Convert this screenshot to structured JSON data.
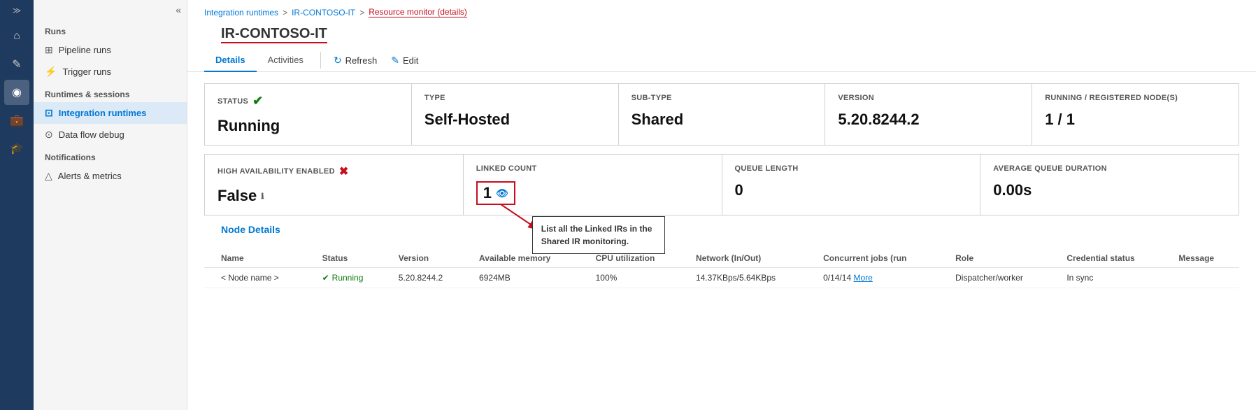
{
  "sidebar": {
    "icons": [
      {
        "name": "expand-icon",
        "symbol": "≫",
        "tooltip": "Expand"
      },
      {
        "name": "home-icon",
        "symbol": "⌂",
        "tooltip": "Home"
      },
      {
        "name": "pencil-icon",
        "symbol": "✎",
        "tooltip": "Author"
      },
      {
        "name": "monitor-icon",
        "symbol": "◉",
        "tooltip": "Monitor",
        "active": true
      },
      {
        "name": "briefcase-icon",
        "symbol": "💼",
        "tooltip": "Manage"
      },
      {
        "name": "graduation-icon",
        "symbol": "🎓",
        "tooltip": "Learn"
      }
    ]
  },
  "leftnav": {
    "collapse_symbol": "«",
    "sections": [
      {
        "label": "Runs",
        "items": [
          {
            "name": "pipeline-runs",
            "icon": "⊞",
            "label": "Pipeline runs"
          },
          {
            "name": "trigger-runs",
            "icon": "⚡",
            "label": "Trigger runs"
          }
        ]
      },
      {
        "label": "Runtimes & sessions",
        "items": [
          {
            "name": "integration-runtimes",
            "icon": "⊡",
            "label": "Integration runtimes",
            "active": true
          },
          {
            "name": "data-flow-debug",
            "icon": "⊙",
            "label": "Data flow debug"
          }
        ]
      },
      {
        "label": "Notifications",
        "items": [
          {
            "name": "alerts-metrics",
            "icon": "△",
            "label": "Alerts & metrics"
          }
        ]
      }
    ]
  },
  "breadcrumb": {
    "items": [
      {
        "label": "Integration runtimes",
        "link": true
      },
      {
        "label": "IR-CONTOSO-IT",
        "link": true
      },
      {
        "label": "Resource monitor (details)",
        "current": true
      }
    ]
  },
  "page_title": "IR-CONTOSO-IT",
  "tabs": [
    {
      "label": "Details",
      "active": true
    },
    {
      "label": "Activities"
    }
  ],
  "toolbar": {
    "refresh_label": "Refresh",
    "refresh_icon": "↻",
    "edit_label": "Edit",
    "edit_icon": "✎"
  },
  "cards_row1": [
    {
      "id": "status",
      "label": "STATUS",
      "value": "Running",
      "icon": "✔",
      "icon_type": "green"
    },
    {
      "id": "type",
      "label": "TYPE",
      "value": "Self-Hosted"
    },
    {
      "id": "subtype",
      "label": "SUB-TYPE",
      "value": "Shared"
    },
    {
      "id": "version",
      "label": "VERSION",
      "value": "5.20.8244.2"
    },
    {
      "id": "running-nodes",
      "label": "RUNNING / REGISTERED NODE(S)",
      "value": "1 / 1"
    }
  ],
  "cards_row2": [
    {
      "id": "ha-enabled",
      "label": "HIGH AVAILABILITY ENABLED",
      "value": "False",
      "icon": "✖",
      "icon_type": "red",
      "info": true
    },
    {
      "id": "linked-count",
      "label": "LINKED COUNT",
      "value": "1",
      "eye": true
    },
    {
      "id": "queue-length",
      "label": "QUEUE LENGTH",
      "value": "0"
    },
    {
      "id": "avg-queue",
      "label": "AVERAGE QUEUE DURATION",
      "value": "0.00s"
    }
  ],
  "tooltip": {
    "text": "List all the Linked IRs in the Shared IR monitoring."
  },
  "node_details": {
    "title": "Node Details",
    "columns": [
      "Name",
      "Status",
      "Version",
      "Available memory",
      "CPU utilization",
      "Network (In/Out)",
      "Concurrent jobs (run",
      "Role",
      "Credential status",
      "Message"
    ],
    "rows": [
      {
        "name": "< Node name >",
        "status": "Running",
        "version": "5.20.8244.2",
        "memory": "6924MB",
        "cpu": "100%",
        "network": "14.37KBps/5.64KBps",
        "concurrent": "0/14/14",
        "more": "More",
        "role": "Dispatcher/worker",
        "credential": "In sync",
        "message": ""
      }
    ]
  }
}
